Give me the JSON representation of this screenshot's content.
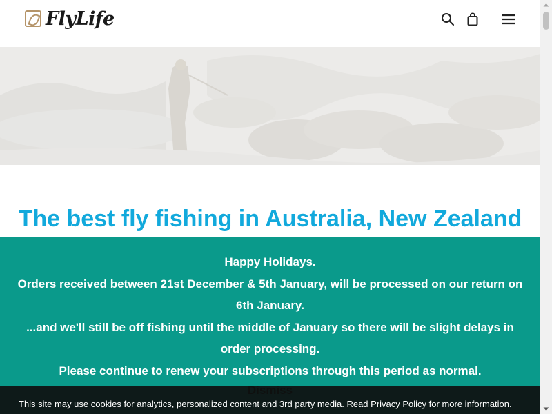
{
  "header": {
    "logo_text": "FlyLife",
    "icons": [
      "search-icon",
      "shopping-bag-icon",
      "hamburger-menu-icon"
    ]
  },
  "hero": {
    "image": "fly-fisher-in-rocky-stream-photo"
  },
  "headline": "The best fly fishing in Australia, New Zealand",
  "notice": {
    "lines": [
      "Happy Holidays.",
      "Orders received between 21st December & 5th January, will be processed on our return on 6th January.",
      "...and we'll still be off fishing until the middle of January so there will be slight delays in order processing.",
      "Please continue to renew your subscriptions through this period as normal."
    ],
    "dismiss_label": "Dismiss"
  },
  "cookie_bar": {
    "text": "This site may use cookies for analytics, personalized content and 3rd party media. Read Privacy Policy for more information."
  },
  "colors": {
    "accent_headline": "#12a9dc",
    "notice_bg": "#0a9a8b",
    "logo_gold": "#b59469"
  }
}
